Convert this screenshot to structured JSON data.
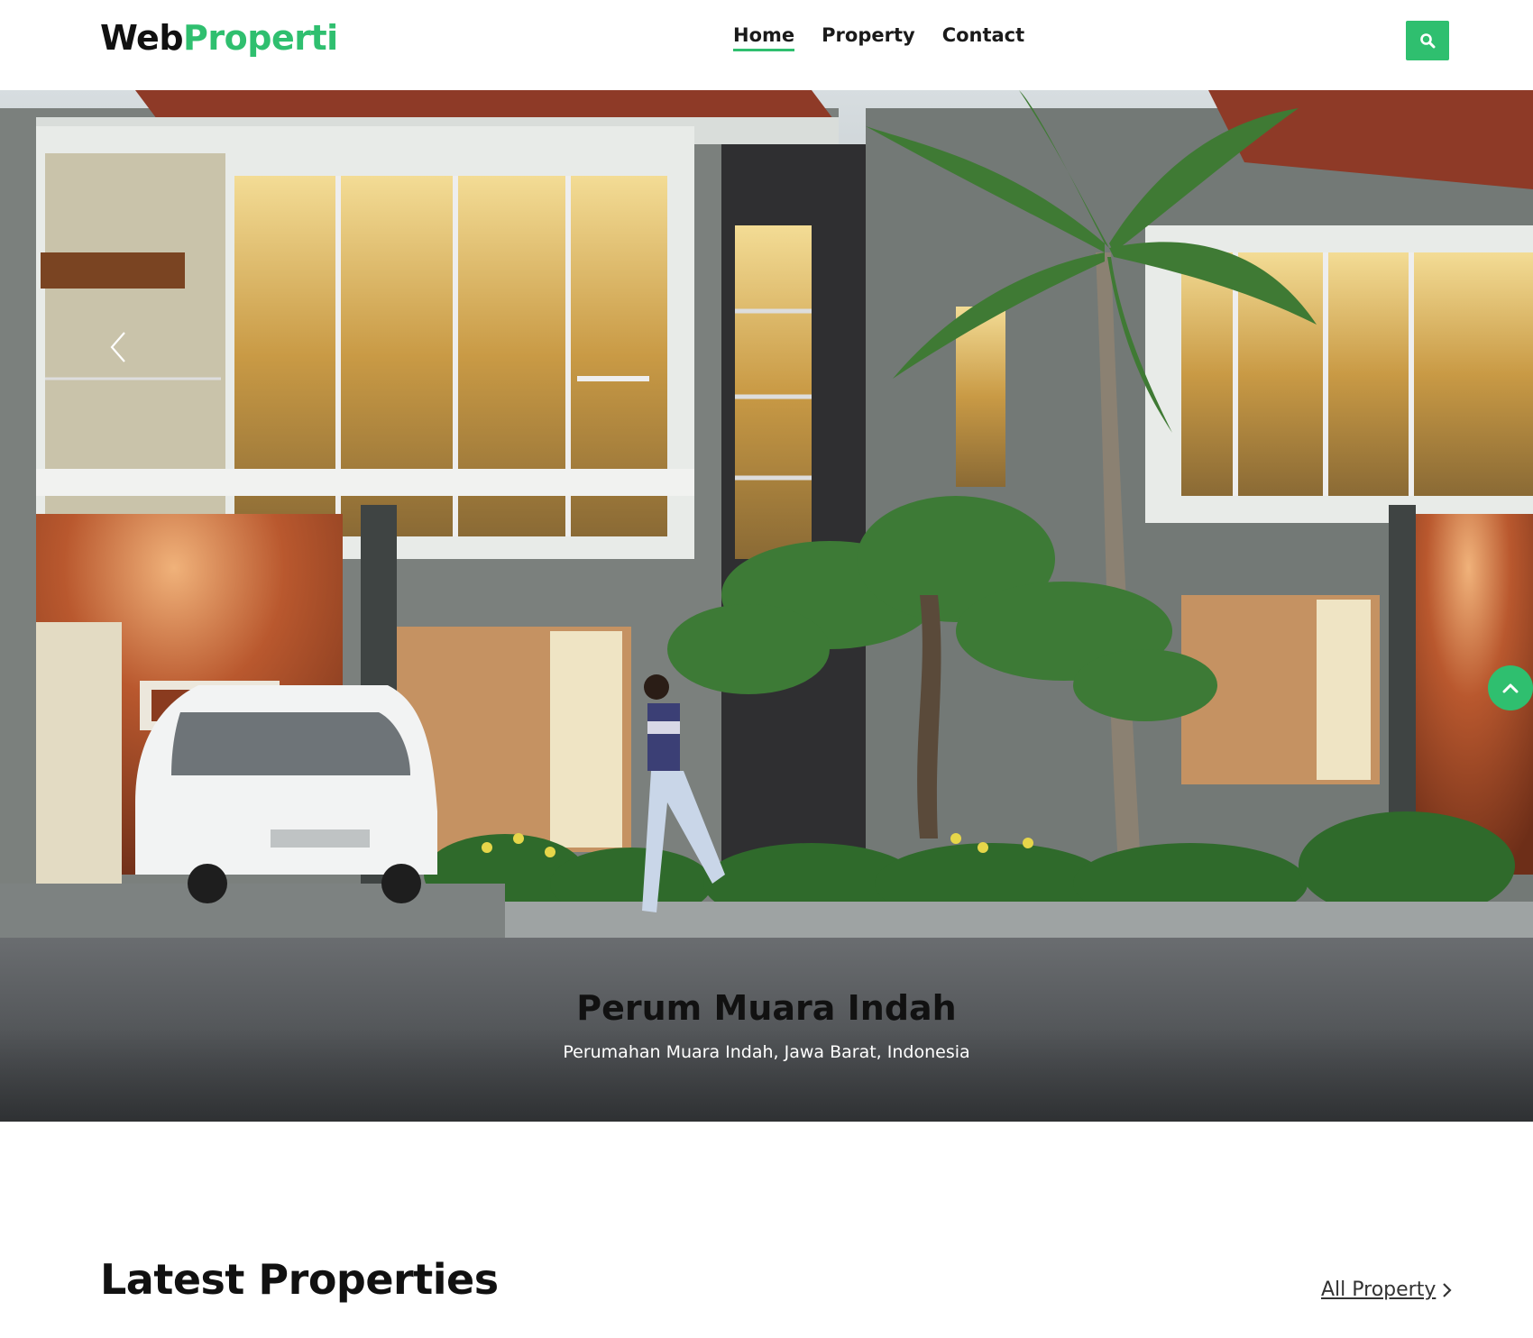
{
  "brand": {
    "part1": "Web",
    "part2": "Properti"
  },
  "nav": {
    "items": [
      {
        "label": "Home",
        "active": true
      },
      {
        "label": "Property",
        "active": false
      },
      {
        "label": "Contact",
        "active": false
      }
    ]
  },
  "search": {
    "icon": "search-icon"
  },
  "hero": {
    "title": "Perum Muara Indah",
    "subtitle": "Perumahan Muara Indah, Jawa Barat, Indonesia",
    "prev_icon": "chevron-left-icon",
    "scroll_icon": "chevron-up-icon"
  },
  "latest": {
    "title": "Latest Properties",
    "all_link": "All Property "
  },
  "colors": {
    "accent": "#2fbf6f",
    "text": "#111111"
  }
}
